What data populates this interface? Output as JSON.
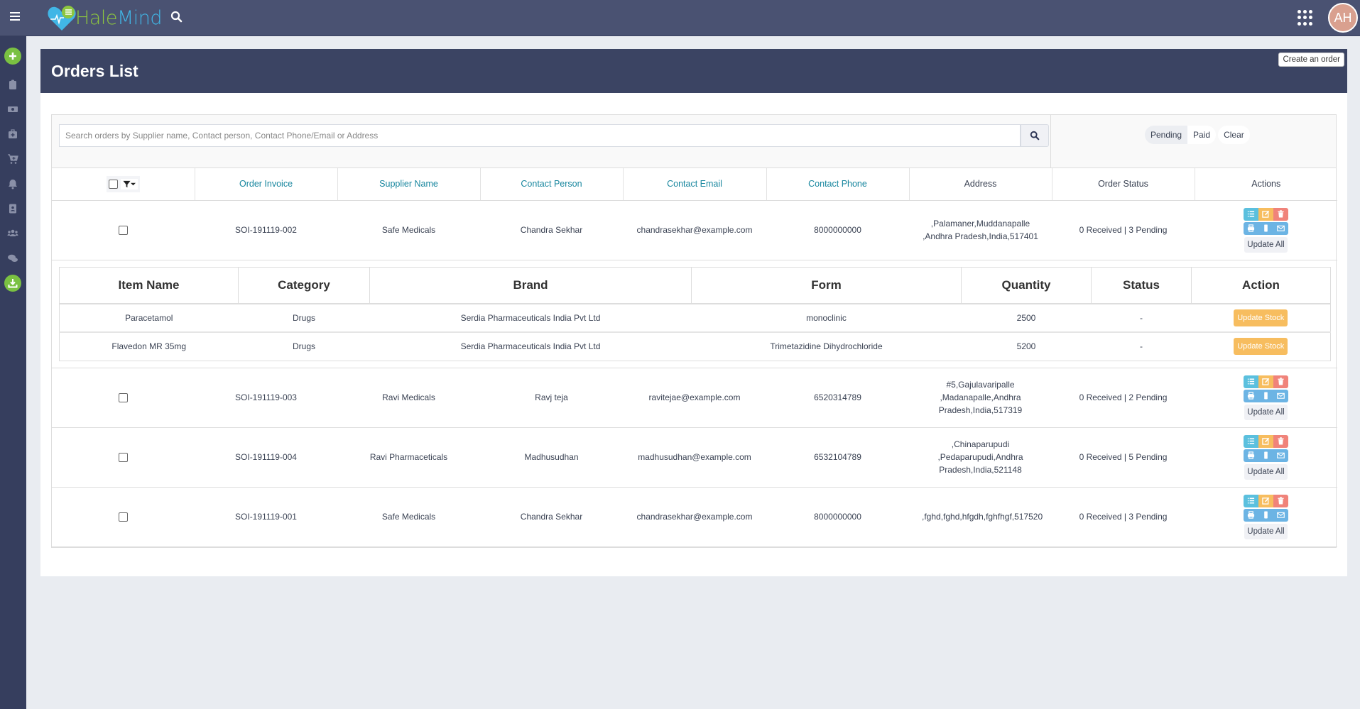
{
  "app": {
    "brand_part1": "Hale",
    "brand_part2": "Mind",
    "user_initials": "AH",
    "colors": {
      "topbar": "#4a5272",
      "sidebar": "#363e5e",
      "accent_green": "#7ac142",
      "link_teal": "#17869e",
      "warning": "#f7bd5f",
      "danger": "#f0837a",
      "info": "#5bc0de"
    }
  },
  "sidebar": {
    "items": [
      {
        "icon": "plus-icon"
      },
      {
        "icon": "clipboard-icon"
      },
      {
        "icon": "money-icon"
      },
      {
        "icon": "medical-kit-icon"
      },
      {
        "icon": "cart-plus-icon"
      },
      {
        "icon": "bell-icon"
      },
      {
        "icon": "address-book-icon"
      },
      {
        "icon": "users-icon"
      },
      {
        "icon": "chat-icon"
      },
      {
        "icon": "download-icon"
      }
    ]
  },
  "page": {
    "title": "Orders List",
    "create_button": "Create an order"
  },
  "search": {
    "placeholder": "Search orders by Supplier name, Contact person, Contact Phone/Email or Address",
    "value": ""
  },
  "status_filter": {
    "options": [
      "Pending",
      "Paid"
    ],
    "selected": "Pending",
    "clear_label": "Clear"
  },
  "table": {
    "columns": [
      "Order Invoice",
      "Supplier Name",
      "Contact Person",
      "Contact Email",
      "Contact Phone",
      "Address",
      "Order Status",
      "Actions"
    ],
    "update_all_label": "Update All",
    "rows": [
      {
        "invoice": "SOI-191119-002",
        "supplier": "Safe Medicals",
        "contact": "Chandra Sekhar",
        "email": "chandrasekhar@example.com",
        "phone": "8000000000",
        "address": ",Palamaner,Muddanapalle ,Andhra Pradesh,India,517401",
        "status": "0 Received | 3 Pending"
      },
      {
        "invoice": "SOI-191119-003",
        "supplier": "Ravi Medicals",
        "contact": "Ravj teja",
        "email": "ravitejae@example.com",
        "phone": "6520314789",
        "address": "#5,Gajulavaripalle ,Madanapalle,Andhra Pradesh,India,517319",
        "status": "0 Received | 2 Pending"
      },
      {
        "invoice": "SOI-191119-004",
        "supplier": "Ravi Pharmaceticals",
        "contact": "Madhusudhan",
        "email": "madhusudhan@example.com",
        "phone": "6532104789",
        "address": ",Chinaparupudi ,Pedaparupudi,Andhra Pradesh,India,521148",
        "status": "0 Received | 5 Pending"
      },
      {
        "invoice": "SOI-191119-001",
        "supplier": "Safe Medicals",
        "contact": "Chandra Sekhar",
        "email": "chandrasekhar@example.com",
        "phone": "8000000000",
        "address": ",fghd,fghd,hfgdh,fghfhgf,517520",
        "status": "0 Received | 3 Pending"
      }
    ]
  },
  "items_table": {
    "columns": [
      "Item Name",
      "Category",
      "Brand",
      "Form",
      "Quantity",
      "Status",
      "Action"
    ],
    "action_label": "Update Stock",
    "rows": [
      {
        "name": "Paracetamol",
        "category": "Drugs",
        "brand": "Serdia Pharmaceuticals India Pvt Ltd",
        "form": "monoclinic",
        "quantity": "2500",
        "status": "-"
      },
      {
        "name": "Flavedon MR 35mg",
        "category": "Drugs",
        "brand": "Serdia Pharmaceuticals India Pvt Ltd",
        "form": "Trimetazidine Dihydrochloride",
        "quantity": "5200",
        "status": "-"
      }
    ]
  }
}
